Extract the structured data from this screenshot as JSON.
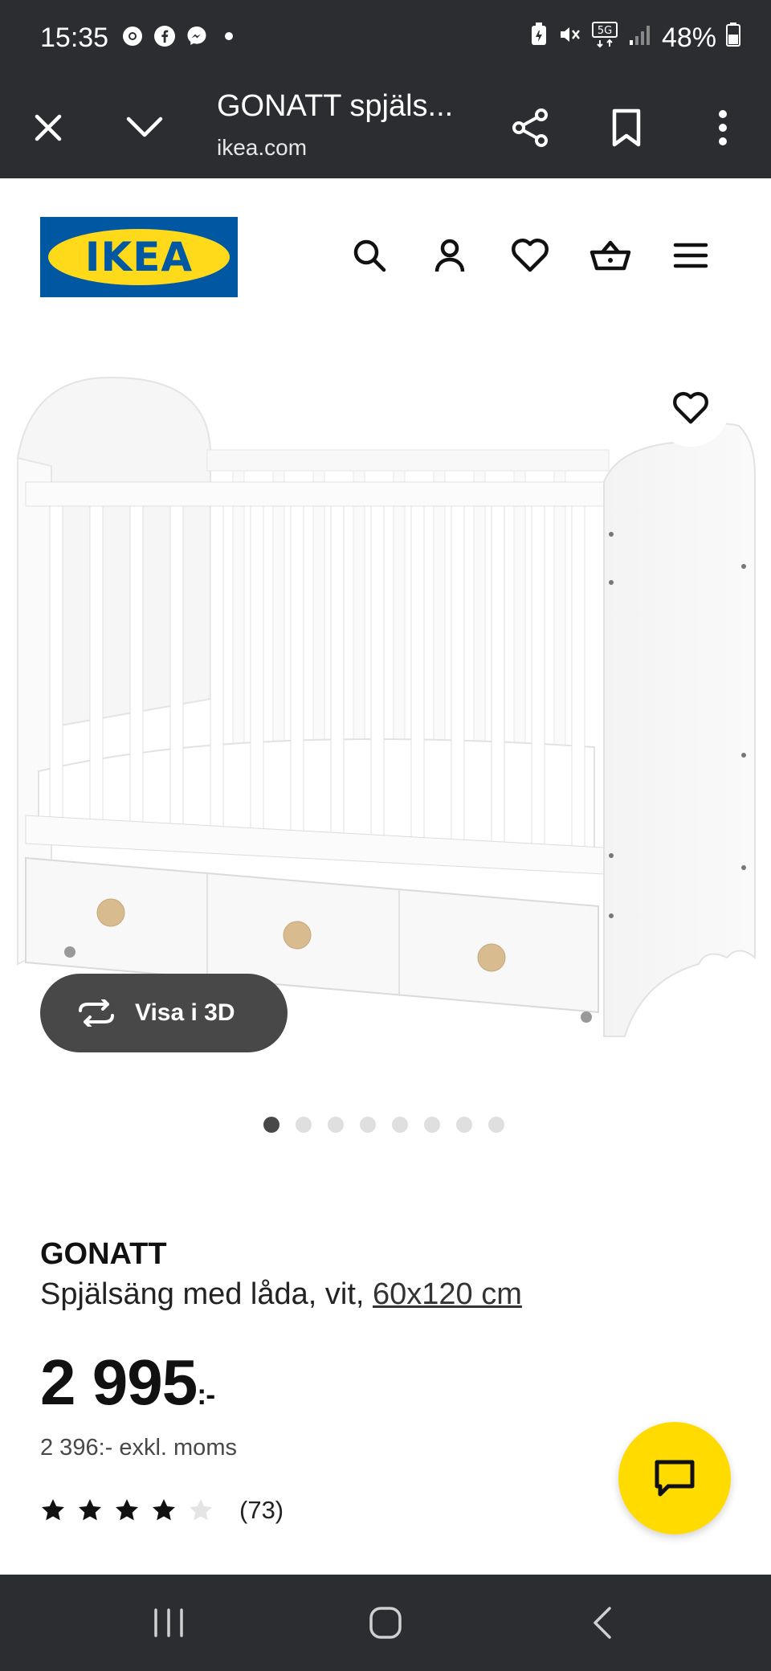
{
  "status_bar": {
    "time": "15:35",
    "battery": "48%",
    "network": "5G"
  },
  "browser": {
    "tab_title": "GONATT spjäls...",
    "url": "ikea.com"
  },
  "header": {
    "logo_text": "IKEA",
    "icons": [
      "search-icon",
      "account-icon",
      "favourites-icon",
      "cart-icon",
      "menu-icon"
    ]
  },
  "gallery": {
    "view_3d_label": "Visa i 3D",
    "image_count": 8,
    "active_index": 0
  },
  "product": {
    "name": "GONATT",
    "description": "Spjälsäng med låda, vit, ",
    "size_link": "60x120 cm",
    "price_main": "2 995",
    "price_suffix": ":-",
    "price_ex_vat": "2 396:- exkl. moms",
    "rating": 4,
    "rating_max": 5,
    "review_count": "(73)"
  },
  "colors": {
    "ikea_blue": "#0058a3",
    "ikea_yellow": "#ffda1a",
    "chrome_dark": "#2b2d31"
  }
}
